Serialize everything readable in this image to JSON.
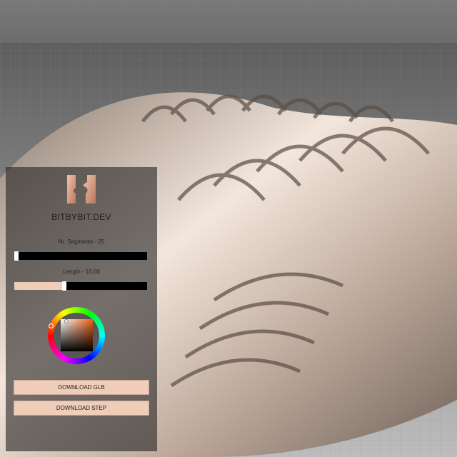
{
  "panel": {
    "brand": "BITBYBIT.DEV",
    "logo_icon": "bitbybit-logo",
    "segments": {
      "label": "Nr. Segments - 25",
      "value": 25,
      "fraction": 0.0
    },
    "length": {
      "label": "Length - 10.00",
      "value": 10.0,
      "fraction": 0.37
    },
    "color": {
      "hex": "#e8601a",
      "hue_icon": "color-wheel"
    },
    "buttons": {
      "download_glb": "DOWNLOAD GLB",
      "download_step": "DOWNLOAD STEP"
    }
  },
  "colors": {
    "accent": "#f0cdb9",
    "model": "#d9c4b4"
  }
}
